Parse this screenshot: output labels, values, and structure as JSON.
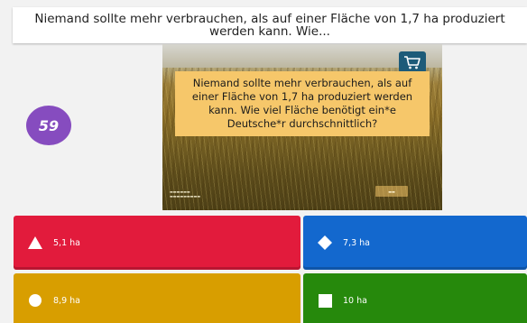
{
  "question": {
    "text": "Niemand sollte mehr verbrauchen, als auf einer Fläche von 1,7 ha produziert werden kann. Wie..."
  },
  "timer": {
    "value": "59"
  },
  "media": {
    "caption": "Niemand sollte mehr verbrauchen, als auf einer Fläche von 1,7 ha produziert werden kann. Wie viel Fläche benötigt ein*e Deutsche*r durchschnittlich?",
    "icon": "shopping-cart-icon"
  },
  "answers": [
    {
      "label": "5,1 ha",
      "shape": "triangle-icon",
      "color": "#e21b3c"
    },
    {
      "label": "7,3 ha",
      "shape": "diamond-icon",
      "color": "#1368ce"
    },
    {
      "label": "8,9 ha",
      "shape": "circle-icon",
      "color": "#d89e00"
    },
    {
      "label": "10 ha",
      "shape": "square-icon",
      "color": "#26890c"
    }
  ],
  "colors": {
    "timer": "#864cbf",
    "caption_background": "#f6c76a"
  }
}
